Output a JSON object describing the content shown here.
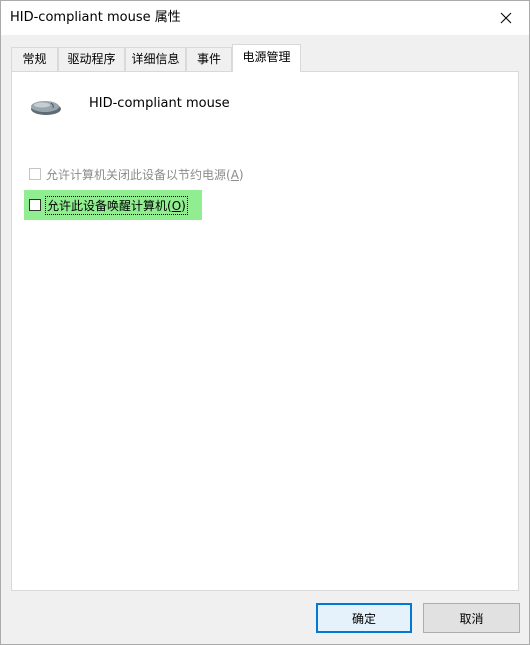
{
  "window": {
    "title": "HID-compliant mouse 属性"
  },
  "tabs": [
    {
      "label": "常规",
      "active": false
    },
    {
      "label": "驱动程序",
      "active": false
    },
    {
      "label": "详细信息",
      "active": false
    },
    {
      "label": "事件",
      "active": false
    },
    {
      "label": "电源管理",
      "active": true
    }
  ],
  "device": {
    "name": "HID-compliant mouse",
    "icon": "mouse-icon"
  },
  "options": [
    {
      "label": "允许计算机关闭此设备以节约电源",
      "accel": "A",
      "checked": false,
      "enabled": false
    },
    {
      "label": "允许此设备唤醒计算机",
      "accel": "O",
      "checked": false,
      "enabled": true
    }
  ],
  "buttons": {
    "ok": "确定",
    "cancel": "取消"
  },
  "colors": {
    "highlight": "#90ee90",
    "default_button_border": "#0078d7"
  }
}
